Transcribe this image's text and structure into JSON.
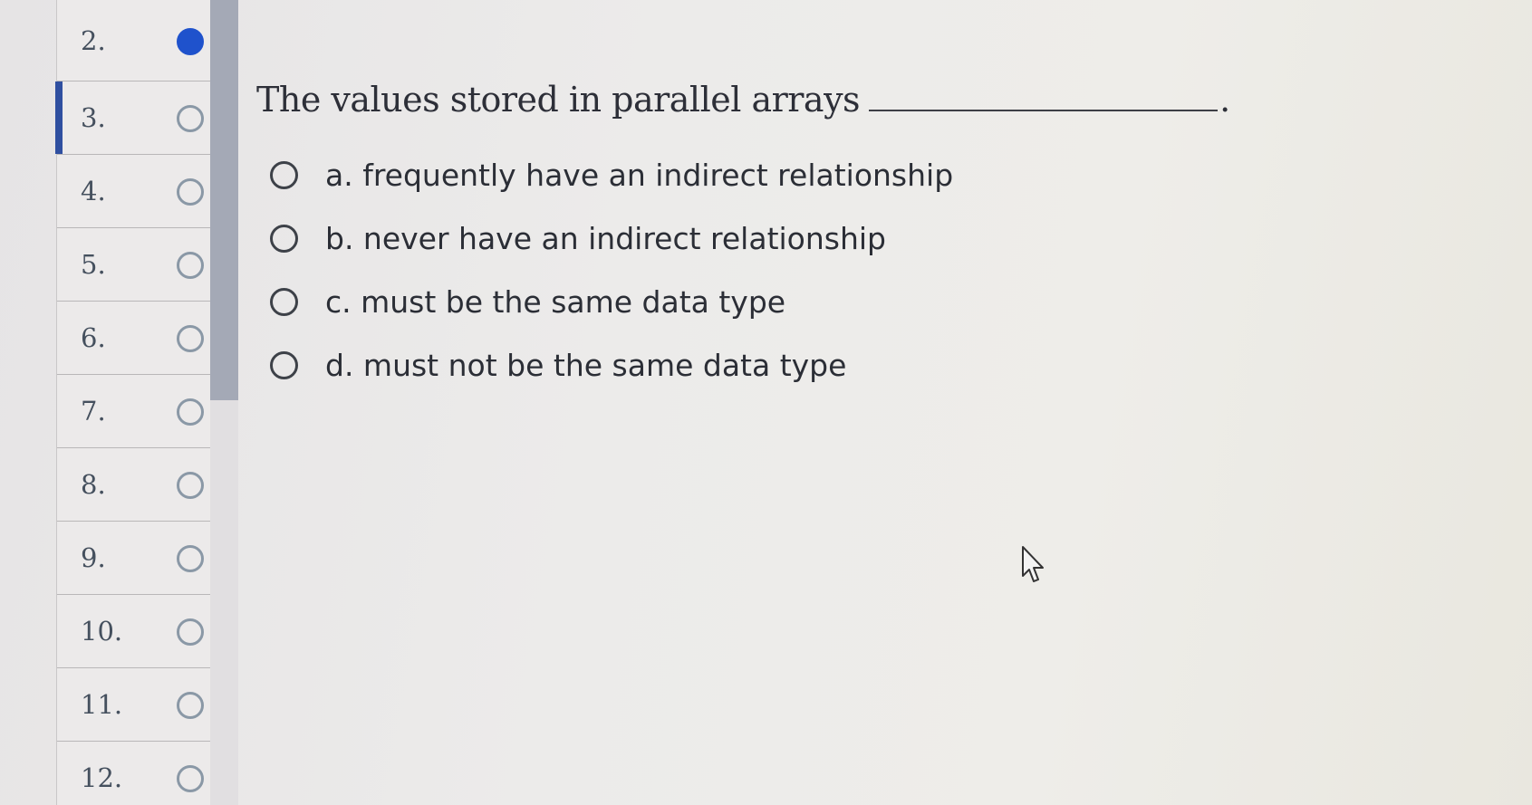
{
  "navigator": {
    "items": [
      {
        "number": "2.",
        "answered": true,
        "current": false
      },
      {
        "number": "3.",
        "answered": false,
        "current": true
      },
      {
        "number": "4.",
        "answered": false,
        "current": false
      },
      {
        "number": "5.",
        "answered": false,
        "current": false
      },
      {
        "number": "6.",
        "answered": false,
        "current": false
      },
      {
        "number": "7.",
        "answered": false,
        "current": false
      },
      {
        "number": "8.",
        "answered": false,
        "current": false
      },
      {
        "number": "9.",
        "answered": false,
        "current": false
      },
      {
        "number": "10.",
        "answered": false,
        "current": false
      },
      {
        "number": "11.",
        "answered": false,
        "current": false
      },
      {
        "number": "12.",
        "answered": false,
        "current": false
      }
    ]
  },
  "question": {
    "text": "The values stored in parallel arrays",
    "terminator": ".",
    "options": [
      {
        "label": "a. frequently have an indirect relationship",
        "selected": false
      },
      {
        "label": "b. never have an indirect relationship",
        "selected": false
      },
      {
        "label": "c. must be the same data type",
        "selected": false
      },
      {
        "label": "d. must not be the same data type",
        "selected": false
      }
    ]
  },
  "colors": {
    "answered_dot": "#1f52cc",
    "current_marker": "#2f4fa0",
    "scroll_thumb": "#a4a9b6"
  }
}
